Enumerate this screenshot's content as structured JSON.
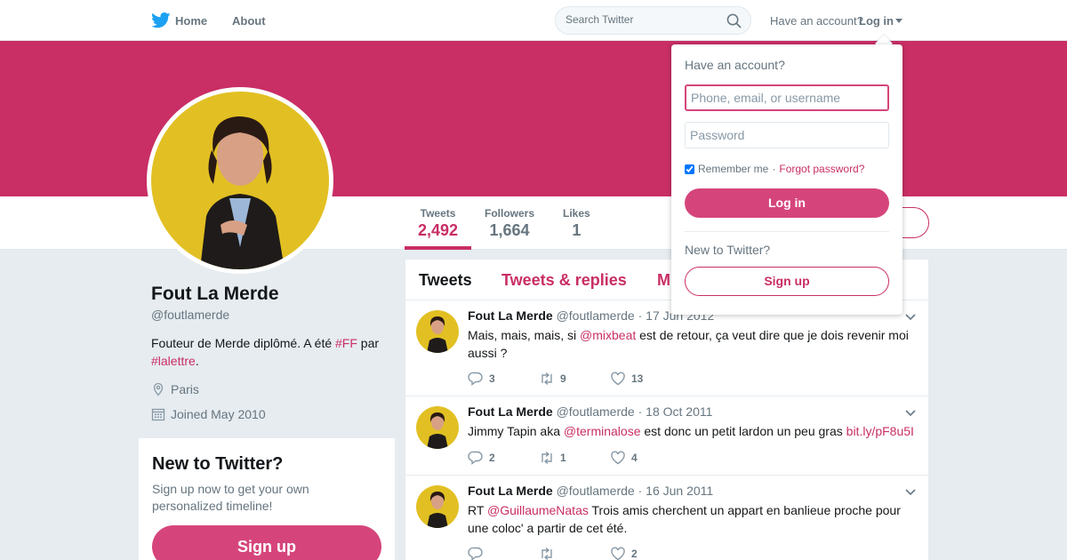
{
  "nav": {
    "home_label": "Home",
    "about_label": "About",
    "search_placeholder": "Search Twitter",
    "have_account": "Have an account?",
    "login_label": "Log in"
  },
  "stats": [
    {
      "label": "Tweets",
      "value": "2,492"
    },
    {
      "label": "Followers",
      "value": "1,664"
    },
    {
      "label": "Likes",
      "value": "1"
    }
  ],
  "profile": {
    "name": "Fout La Merde",
    "handle": "@foutlamerde",
    "bio_prefix": "Fouteur de Merde diplômé. A été ",
    "bio_tag1": "#FF",
    "bio_mid": " par ",
    "bio_tag2": "#lalettre",
    "bio_suffix": ".",
    "location": "Paris",
    "joined": "Joined May 2010"
  },
  "new_to_twitter": {
    "title": "New to Twitter?",
    "text": "Sign up now to get your own personalized timeline!",
    "button": "Sign up"
  },
  "timeline_tabs": [
    "Tweets",
    "Tweets & replies",
    "M"
  ],
  "tweets": [
    {
      "name": "Fout La Merde",
      "handle": "@foutlamerde",
      "date": "· 17 Jun 2012",
      "text_a": "Mais, mais, mais, si ",
      "link": "@mixbeat",
      "text_b": " est de retour, ça veut dire que je dois revenir moi aussi ?",
      "link2": "",
      "text_c": "",
      "replies": "3",
      "retweets": "9",
      "likes": "13"
    },
    {
      "name": "Fout La Merde",
      "handle": "@foutlamerde",
      "date": "· 18 Oct 2011",
      "text_a": "Jimmy Tapin aka ",
      "link": "@terminalose",
      "text_b": " est donc un petit lardon un peu gras ",
      "link2": "bit.ly/pF8u5I",
      "text_c": "",
      "replies": "2",
      "retweets": "1",
      "likes": "4"
    },
    {
      "name": "Fout La Merde",
      "handle": "@foutlamerde",
      "date": "· 16 Jun 2011",
      "text_a": "RT ",
      "link": "@GuillaumeNatas",
      "text_b": " Trois amis cherchent un appart en banlieue proche pour une coloc' a partir de cet été.",
      "link2": "",
      "text_c": "",
      "replies": "",
      "retweets": "",
      "likes": "2"
    }
  ],
  "login_dropdown": {
    "title": "Have an account?",
    "username_placeholder": "Phone, email, or username",
    "password_placeholder": "Password",
    "remember": "Remember me",
    "separator": " · ",
    "forgot": "Forgot password?",
    "login_button": "Log in",
    "new_text": "New to Twitter?",
    "signup_button": "Sign up"
  },
  "colors": {
    "accent": "#c92e65",
    "button": "#d5457b",
    "twitter_blue": "#1da1f2"
  },
  "icons": [
    "twitter-bird-icon",
    "search-icon",
    "caret-down-icon",
    "location-pin-icon",
    "calendar-icon",
    "reply-icon",
    "retweet-icon",
    "heart-icon",
    "chevron-down-icon"
  ]
}
